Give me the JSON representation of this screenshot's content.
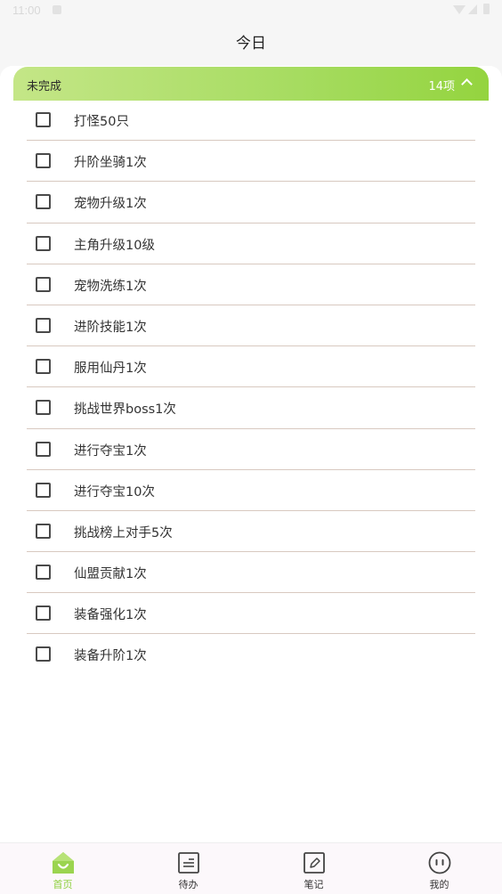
{
  "status_bar": {
    "time": "11:00"
  },
  "title": "今日",
  "group": {
    "label": "未完成",
    "count": "14项"
  },
  "tasks": [
    "打怪50只",
    "升阶坐骑1次",
    "宠物升级1次",
    "主角升级10级",
    "宠物洗练1次",
    "进阶技能1次",
    "服用仙丹1次",
    "挑战世界boss1次",
    "进行夺宝1次",
    "进行夺宝10次",
    "挑战榜上对手5次",
    "仙盟贡献1次",
    "装备强化1次",
    "装备升阶1次"
  ],
  "nav": {
    "home": "首页",
    "todo": "待办",
    "notes": "笔记",
    "mine": "我的"
  },
  "colors": {
    "accent": "#8ccf3a",
    "header_start": "#c4e687",
    "header_end": "#94d43f"
  }
}
